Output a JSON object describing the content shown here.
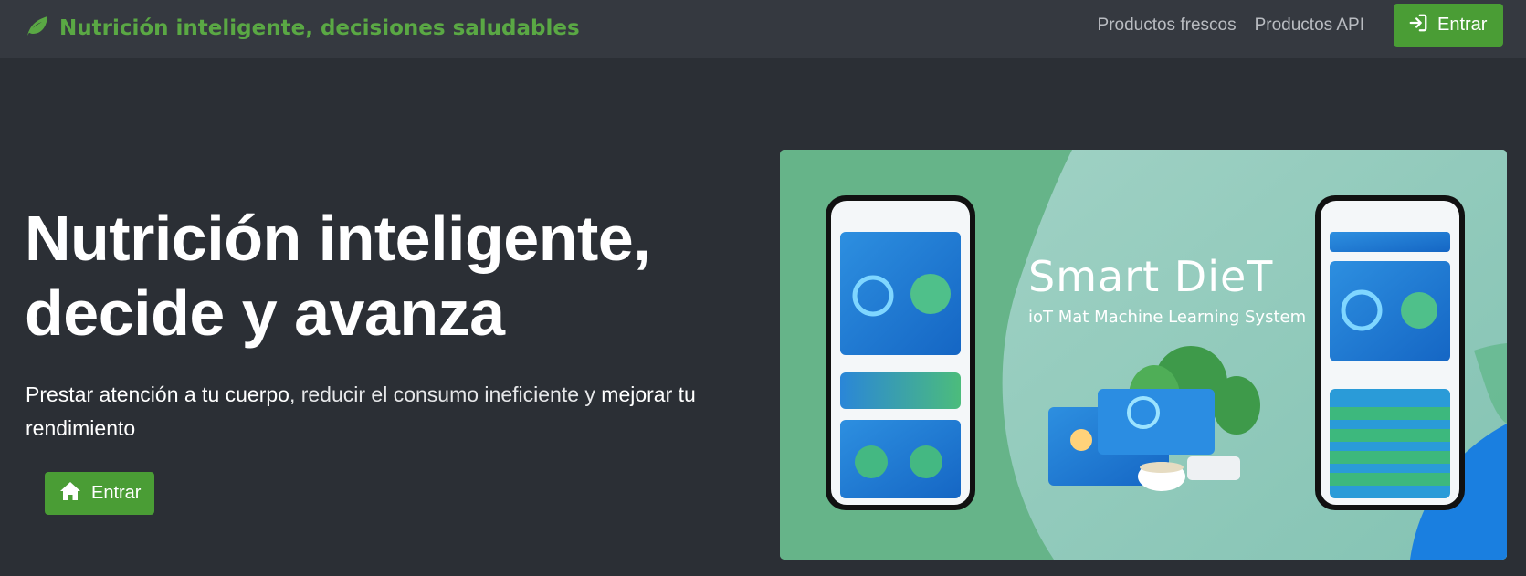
{
  "navbar": {
    "brand_icon": "leaf-icon",
    "brand_text": "Nutrición inteligente, decisiones saludables",
    "links": [
      "Productos frescos",
      "Productos API"
    ],
    "login_icon": "sign-in-icon",
    "login_label": "Entrar"
  },
  "hero": {
    "title_line1": "Nutrición inteligente,",
    "title_line2": "decide y avanza",
    "subtitle": {
      "part1": "Prestar atención a tu cuerpo",
      "part2": ", reducir el consumo ineficiente y ",
      "part3": "mejorar tu rendimiento"
    },
    "button_icon": "home-icon",
    "button_label": "Entrar"
  },
  "hero_image": {
    "title": "Smart DieT",
    "subtitle": "ioT Mat Machine Learning System"
  },
  "colors": {
    "page_bg": "#2b2f35",
    "navbar_bg": "#353940",
    "brand_green": "#5aa844",
    "button_green": "#4a9d35",
    "nav_link": "#b9bcc1"
  }
}
